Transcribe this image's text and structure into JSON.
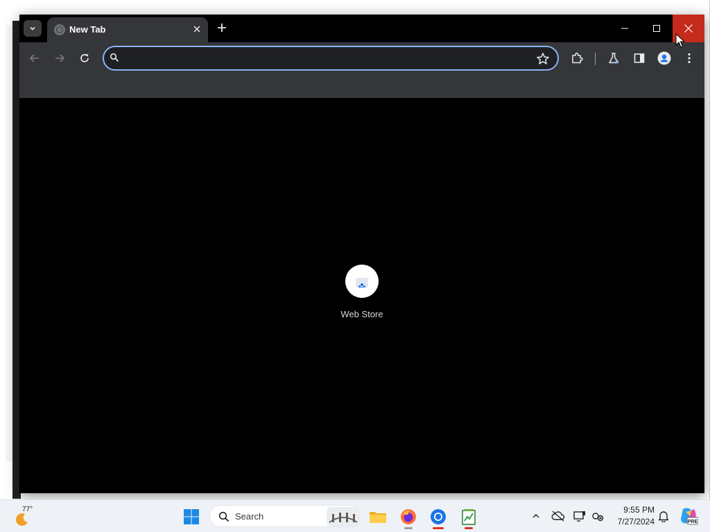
{
  "browser": {
    "tab": {
      "title": "New Tab"
    },
    "omnibox": {
      "value": "",
      "placeholder": ""
    },
    "shortcuts": [
      {
        "label": "Web Store",
        "icon": "web-store-icon"
      }
    ]
  },
  "taskbar": {
    "weather": {
      "temperature": "77°"
    },
    "search": {
      "label": "Search"
    },
    "clock": {
      "time": "9:55 PM",
      "date": "7/27/2024"
    },
    "copilot_badge": "PRE"
  },
  "colors": {
    "close_button": "#c42b1c",
    "omnibox_focus": "#8ab4f8",
    "toolbar": "#35363a"
  }
}
